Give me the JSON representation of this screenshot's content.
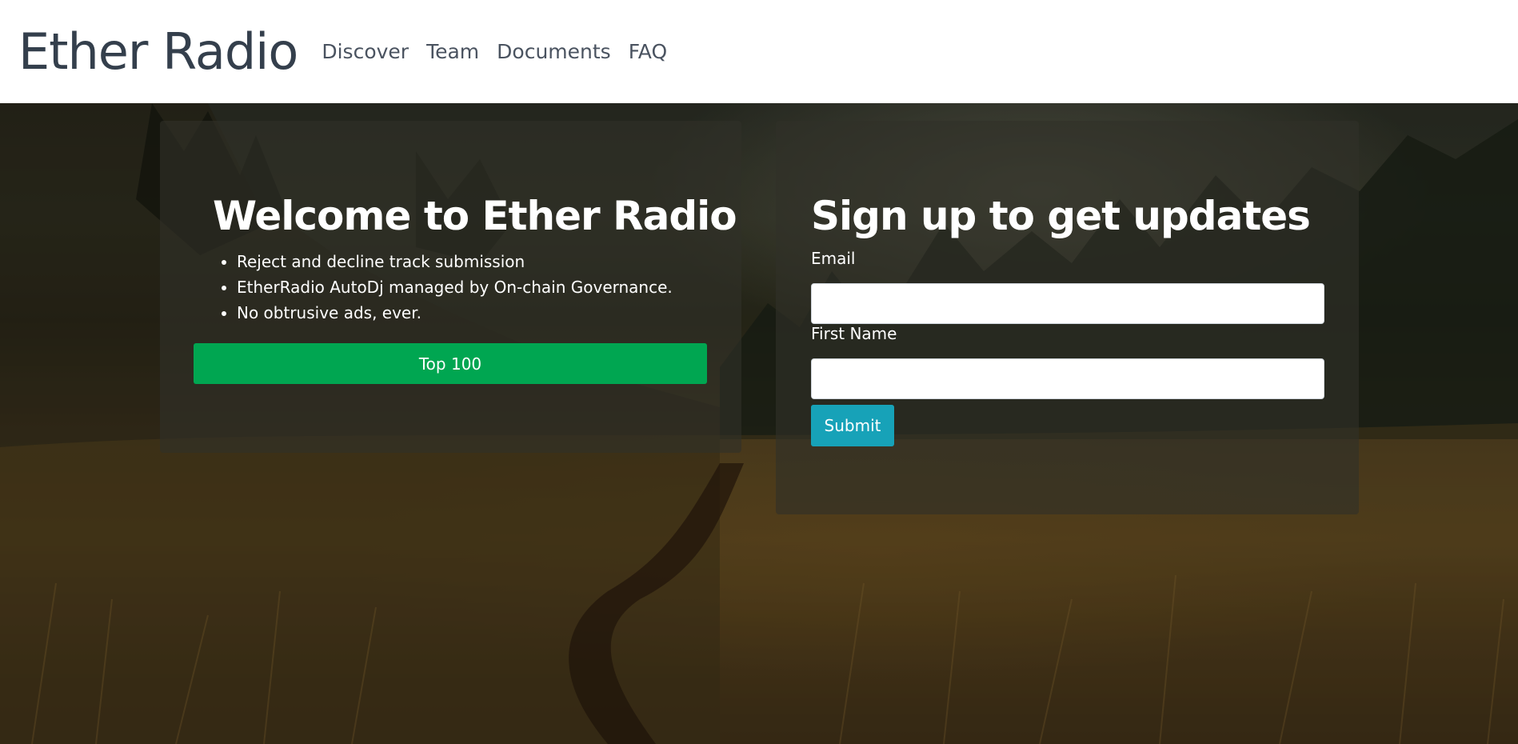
{
  "navbar": {
    "brand": "Ether Radio",
    "links": [
      {
        "label": "Discover"
      },
      {
        "label": "Team"
      },
      {
        "label": "Documents"
      },
      {
        "label": "FAQ"
      }
    ]
  },
  "welcome": {
    "title": "Welcome to Ether Radio",
    "features": [
      "Reject and decline track submission",
      "EtherRadio AutoDj managed by On-chain Governance.",
      "No obtrusive ads, ever."
    ],
    "button_label": "Top 100"
  },
  "signup": {
    "title": "Sign up to get updates",
    "email_label": "Email",
    "email_value": "",
    "first_name_label": "First Name",
    "first_name_value": "",
    "submit_label": "Submit"
  },
  "colors": {
    "brand_text": "#343f4c",
    "primary_button": "#00a651",
    "submit_button": "#17a2b8"
  }
}
